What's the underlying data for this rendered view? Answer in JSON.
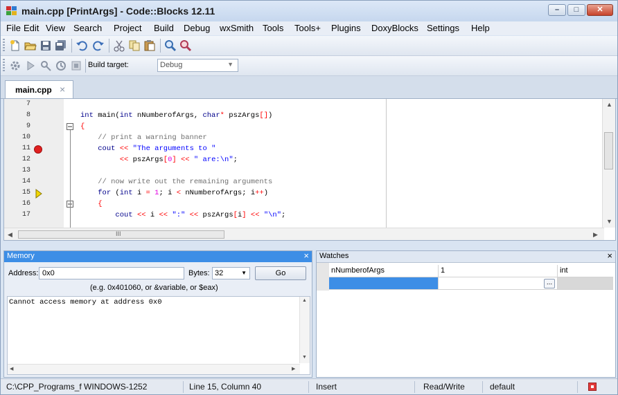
{
  "window": {
    "title": "main.cpp [PrintArgs] - Code::Blocks 12.11",
    "controls": [
      "minimize",
      "maximize",
      "close"
    ]
  },
  "menu": [
    "File",
    "Edit",
    "View",
    "Search",
    "Project",
    "Build",
    "Debug",
    "wxSmith",
    "Tools",
    "Tools+",
    "Plugins",
    "DoxyBlocks",
    "Settings",
    "Help"
  ],
  "toolbar": {
    "icons": [
      "new-file-icon",
      "open-icon",
      "save-icon",
      "save-all-icon",
      "undo-icon",
      "redo-icon",
      "cut-icon",
      "copy-icon",
      "paste-icon",
      "find-icon",
      "replace-icon"
    ],
    "build_target_label": "Build target:",
    "build_target_value": "Debug"
  },
  "editor": {
    "tab_label": "main.cpp",
    "tab_close": "×",
    "lines": [
      {
        "num": "7",
        "code": ""
      },
      {
        "num": "8",
        "code": "int main(int nNumberofArgs, char* pszArgs[])"
      },
      {
        "num": "9",
        "code": "{"
      },
      {
        "num": "10",
        "code": "    // print a warning banner"
      },
      {
        "num": "11",
        "code": "    cout << \"The arguments to \""
      },
      {
        "num": "12",
        "code": "         << pszArgs[0] << \" are:\\n\";"
      },
      {
        "num": "13",
        "code": ""
      },
      {
        "num": "14",
        "code": "    // now write out the remaining arguments"
      },
      {
        "num": "15",
        "code": "    for (int i = 1; i < nNumberofArgs; i++)"
      },
      {
        "num": "16",
        "code": "    {"
      },
      {
        "num": "17",
        "code": "        cout << i << \":\" << pszArgs[i] << \"\\n\";"
      }
    ],
    "breakpoint_line": "11",
    "current_line": "15",
    "hscroll_grip": "III"
  },
  "memory": {
    "title": "Memory",
    "close": "×",
    "address_label": "Address:",
    "address_value": "0x0",
    "bytes_label": "Bytes:",
    "bytes_value": "32",
    "go_label": "Go",
    "hint": "(e.g. 0x401060, or &variable, or $eax)",
    "output": "Cannot access memory at address 0x0"
  },
  "watches": {
    "title": "Watches",
    "close": "×",
    "rows": [
      {
        "name": "nNumberofArgs",
        "value": "1",
        "type": "int"
      }
    ],
    "ellipsis": "..."
  },
  "status": {
    "path": "C:\\CPP_Programs_f WINDOWS-1252",
    "position": "Line 15, Column 40",
    "mode": "Insert",
    "access": "Read/Write",
    "lang": "default"
  },
  "colors": {
    "accent": "#3d8ee6",
    "breakpoint": "#e02020",
    "current_line_arrow": "#f2d600"
  }
}
